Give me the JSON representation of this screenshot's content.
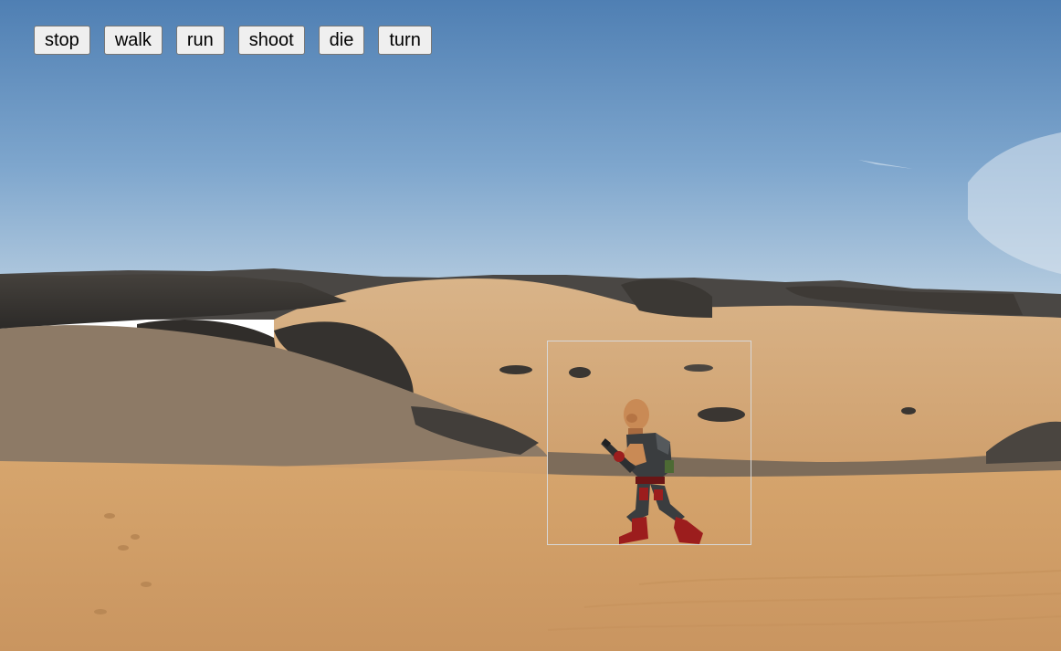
{
  "controls": {
    "buttons": [
      {
        "label": "stop",
        "action": "stop"
      },
      {
        "label": "walk",
        "action": "walk"
      },
      {
        "label": "run",
        "action": "run"
      },
      {
        "label": "shoot",
        "action": "shoot"
      },
      {
        "label": "die",
        "action": "die"
      },
      {
        "label": "turn",
        "action": "turn"
      }
    ]
  },
  "scene": {
    "background": "desert-panorama",
    "sky_color": "#5f8fbf",
    "sand_color": "#d8a86e",
    "rock_color": "#3c3a38"
  },
  "character": {
    "name": "soldier-sprite",
    "state": "walk",
    "facing": "left",
    "skin_color": "#c98a55",
    "armor_color": "#3a3d3f",
    "accent_color": "#9c1d1d"
  }
}
